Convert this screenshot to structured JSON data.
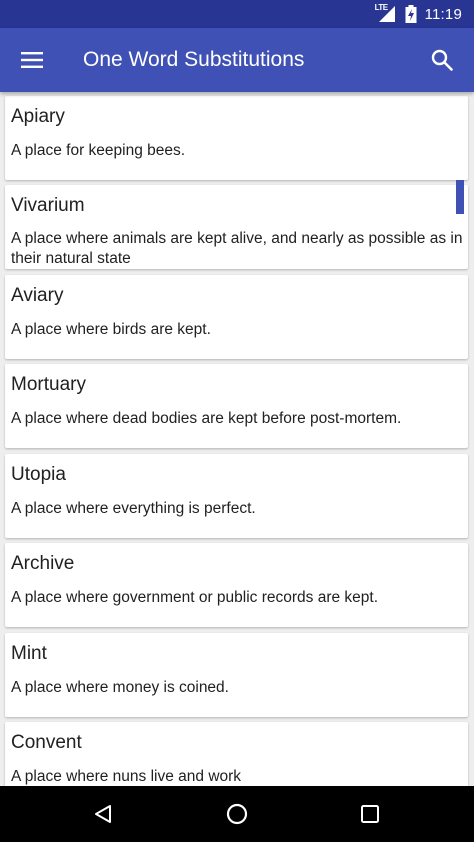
{
  "status_bar": {
    "network_label": "LTE",
    "time": "11:19"
  },
  "app_bar": {
    "title": "One Word Substitutions",
    "menu_icon": "hamburger-menu-icon",
    "search_icon": "search-icon"
  },
  "list": {
    "items": [
      {
        "word": "Apiary",
        "definition": "A place for keeping bees."
      },
      {
        "word": "Vivarium",
        "definition": "A place where animals are kept alive, and nearly as possible as in their natural state"
      },
      {
        "word": "Aviary",
        "definition": "A place where birds are kept."
      },
      {
        "word": "Mortuary",
        "definition": "A place where dead bodies are kept before post-mortem."
      },
      {
        "word": "Utopia",
        "definition": "A place where everything is perfect."
      },
      {
        "word": "Archive",
        "definition": "A place where government or public records are kept."
      },
      {
        "word": "Mint",
        "definition": "A place where money is coined."
      },
      {
        "word": "Convent",
        "definition": "A place where nuns live and work"
      }
    ]
  },
  "nav_bar": {
    "back_icon": "back-triangle-icon",
    "home_icon": "home-circle-icon",
    "recents_icon": "recents-square-icon"
  },
  "colors": {
    "status_bar": "#283593",
    "app_bar": "#3f51b5",
    "accent": "#3f51b5",
    "background": "#eeeeee",
    "card": "#ffffff",
    "nav_bar": "#000000"
  }
}
